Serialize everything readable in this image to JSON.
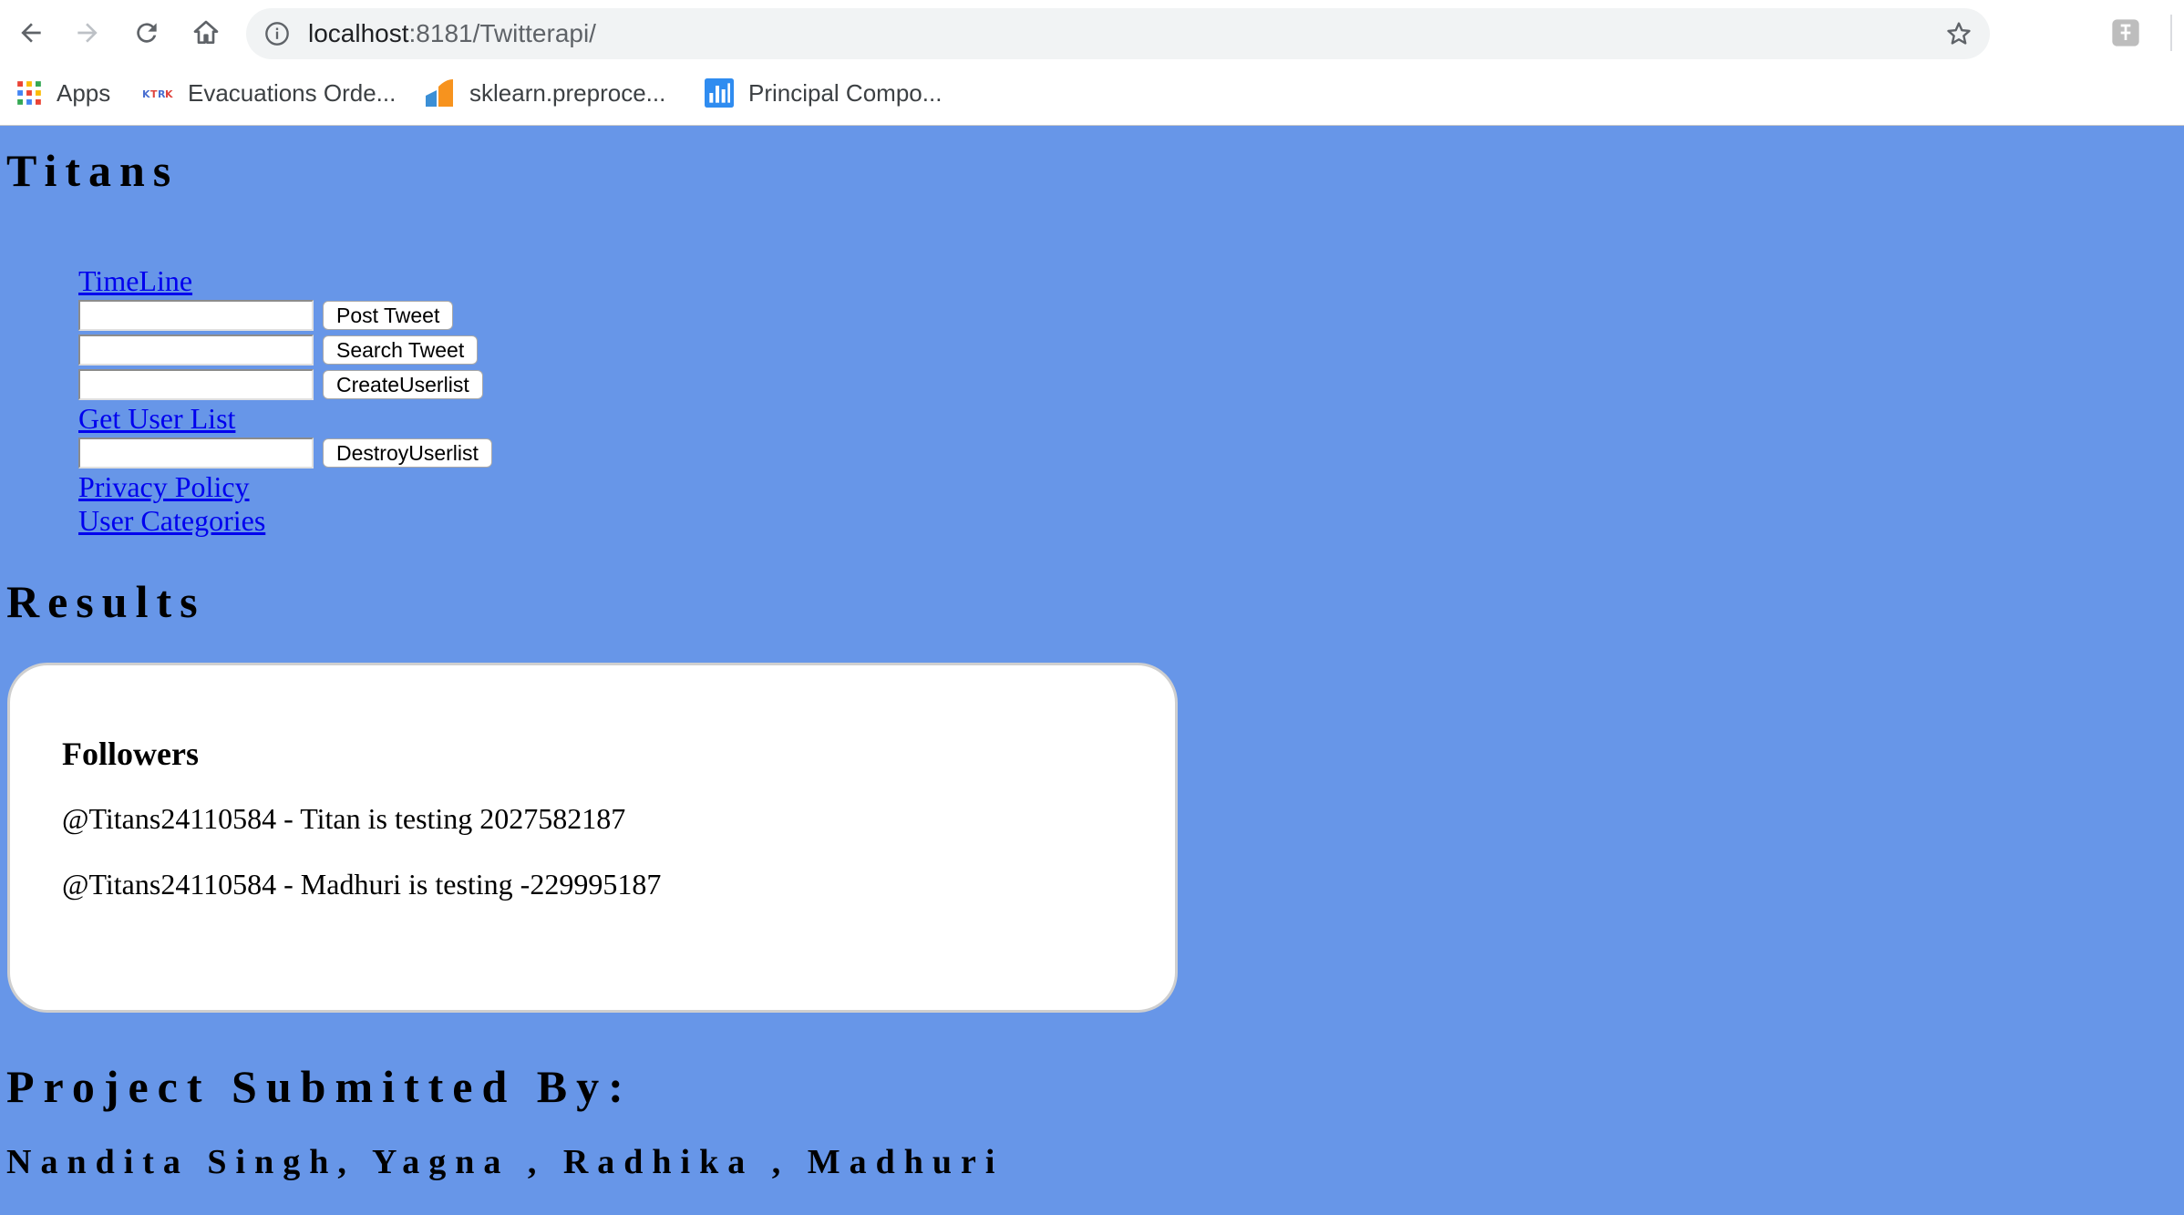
{
  "browser": {
    "url_host": "localhost",
    "url_rest": ":8181/Twitterapi/",
    "bookmarks": [
      {
        "label": "Apps",
        "icon": "apps-grid-icon"
      },
      {
        "label": "Evacuations Orde...",
        "icon": "site-favicon-icon"
      },
      {
        "label": "sklearn.preproce...",
        "icon": "sklearn-favicon-icon"
      },
      {
        "label": "Principal Compo...",
        "icon": "chart-favicon-icon"
      }
    ]
  },
  "page": {
    "title": "Titans",
    "menu": {
      "timeline_link": "TimeLine",
      "post_tweet_button": "Post Tweet",
      "search_tweet_button": "Search Tweet",
      "create_userlist_button": "CreateUserlist",
      "get_user_list_link": "Get User List",
      "destroy_userlist_button": "DestroyUserlist",
      "privacy_policy_link": "Privacy Policy",
      "user_categories_link": "User Categories"
    },
    "results": {
      "title": "Results",
      "heading": "Followers",
      "items": [
        "@Titans24110584 - Titan is testing 2027582187",
        "@Titans24110584 - Madhuri is testing -229995187"
      ]
    },
    "footer": {
      "title": "Project Submitted By:",
      "names": "Nandita Singh, Yagna , Radhika , Madhuri"
    }
  },
  "colors": {
    "page_background": "#6796e8",
    "link": "#0000ee"
  }
}
